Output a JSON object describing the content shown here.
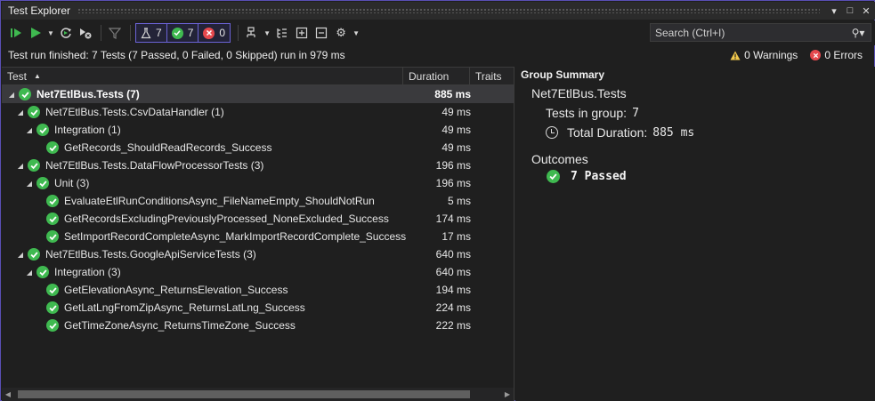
{
  "window": {
    "title": "Test Explorer"
  },
  "toolbar": {
    "counters": {
      "total": "7",
      "passed": "7",
      "failed": "0"
    },
    "search_placeholder": "Search (Ctrl+I)"
  },
  "status": {
    "message": "Test run finished: 7 Tests (7 Passed, 0 Failed, 0 Skipped) run in 979 ms",
    "warnings": "0 Warnings",
    "errors": "0 Errors"
  },
  "columns": {
    "test": "Test",
    "duration": "Duration",
    "traits": "Traits"
  },
  "rows": [
    {
      "label": "Net7EtlBus.Tests  (7)",
      "duration": "885 ms"
    },
    {
      "label": "Net7EtlBus.Tests.CsvDataHandler  (1)",
      "duration": "49 ms"
    },
    {
      "label": "Integration  (1)",
      "duration": "49 ms"
    },
    {
      "label": "GetRecords_ShouldReadRecords_Success",
      "duration": "49 ms"
    },
    {
      "label": "Net7EtlBus.Tests.DataFlowProcessorTests  (3)",
      "duration": "196 ms"
    },
    {
      "label": "Unit  (3)",
      "duration": "196 ms"
    },
    {
      "label": "EvaluateEtlRunConditionsAsync_FileNameEmpty_ShouldNotRun",
      "duration": "5 ms"
    },
    {
      "label": "GetRecordsExcludingPreviouslyProcessed_NoneExcluded_Success",
      "duration": "174 ms"
    },
    {
      "label": "SetImportRecordCompleteAsync_MarkImportRecordComplete_Success",
      "duration": "17 ms"
    },
    {
      "label": "Net7EtlBus.Tests.GoogleApiServiceTests  (3)",
      "duration": "640 ms"
    },
    {
      "label": "Integration  (3)",
      "duration": "640 ms"
    },
    {
      "label": "GetElevationAsync_ReturnsElevation_Success",
      "duration": "194 ms"
    },
    {
      "label": "GetLatLngFromZipAsync_ReturnsLatLng_Success",
      "duration": "224 ms"
    },
    {
      "label": "GetTimeZoneAsync_ReturnsTimeZone_Success",
      "duration": "222 ms"
    }
  ],
  "summary": {
    "header": "Group Summary",
    "group_name": "Net7EtlBus.Tests",
    "tests_in_group_label": "Tests in group:",
    "tests_in_group_value": "7",
    "total_duration_label": "Total Duration:",
    "total_duration_value": "885 ms",
    "outcomes_label": "Outcomes",
    "passed_text": "7 Passed"
  },
  "colors": {
    "accent": "#6b63d6",
    "pass": "#3fb950",
    "fail": "#e5484d",
    "warn": "#f2c94c"
  }
}
